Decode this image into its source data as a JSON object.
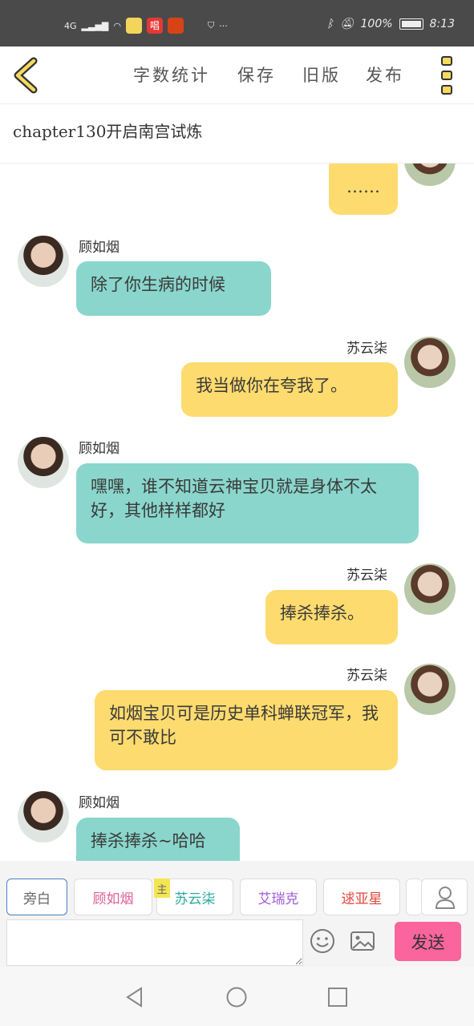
{
  "status_bar": {
    "network": "4G",
    "battery": "100%",
    "time": "8:13",
    "app_badge_text": "唱"
  },
  "toolbar": {
    "buttons": [
      "字数统计",
      "保存",
      "旧版",
      "发布"
    ]
  },
  "chapter_title": "chapter130开启南宫试炼",
  "messages": [
    {
      "side": "right",
      "text": "……"
    },
    {
      "side": "left",
      "name": "顾如烟",
      "text": "除了你生病的时候"
    },
    {
      "side": "right",
      "name": "苏云柒",
      "text": "我当做你在夸我了。"
    },
    {
      "side": "left",
      "name": "顾如烟",
      "text": "嘿嘿，谁不知道云神宝贝就是身体不太好，其他样样都好"
    },
    {
      "side": "right",
      "name": "苏云柒",
      "text": "捧杀捧杀。"
    },
    {
      "side": "right",
      "name": "苏云柒",
      "text": "如烟宝贝可是历史单科蝉联冠军，我可不敢比"
    },
    {
      "side": "left",
      "name": "顾如烟",
      "text": "捧杀捧杀~哈哈"
    }
  ],
  "characters": [
    {
      "label": "旁白",
      "color": "#666666"
    },
    {
      "label": "顾如烟",
      "color": "#e0609a"
    },
    {
      "label": "苏云柒",
      "color": "#2aa8a0",
      "tag": "主"
    },
    {
      "label": "艾瑞克",
      "color": "#a05bd6"
    },
    {
      "label": "逑亚星",
      "color": "#e0473a"
    }
  ],
  "input": {
    "placeholder": "",
    "send_label": "发送"
  },
  "colors": {
    "teal_bubble": "#8ad6cc",
    "yellow_bubble": "#fedb6e",
    "send_button": "#f9659c"
  }
}
